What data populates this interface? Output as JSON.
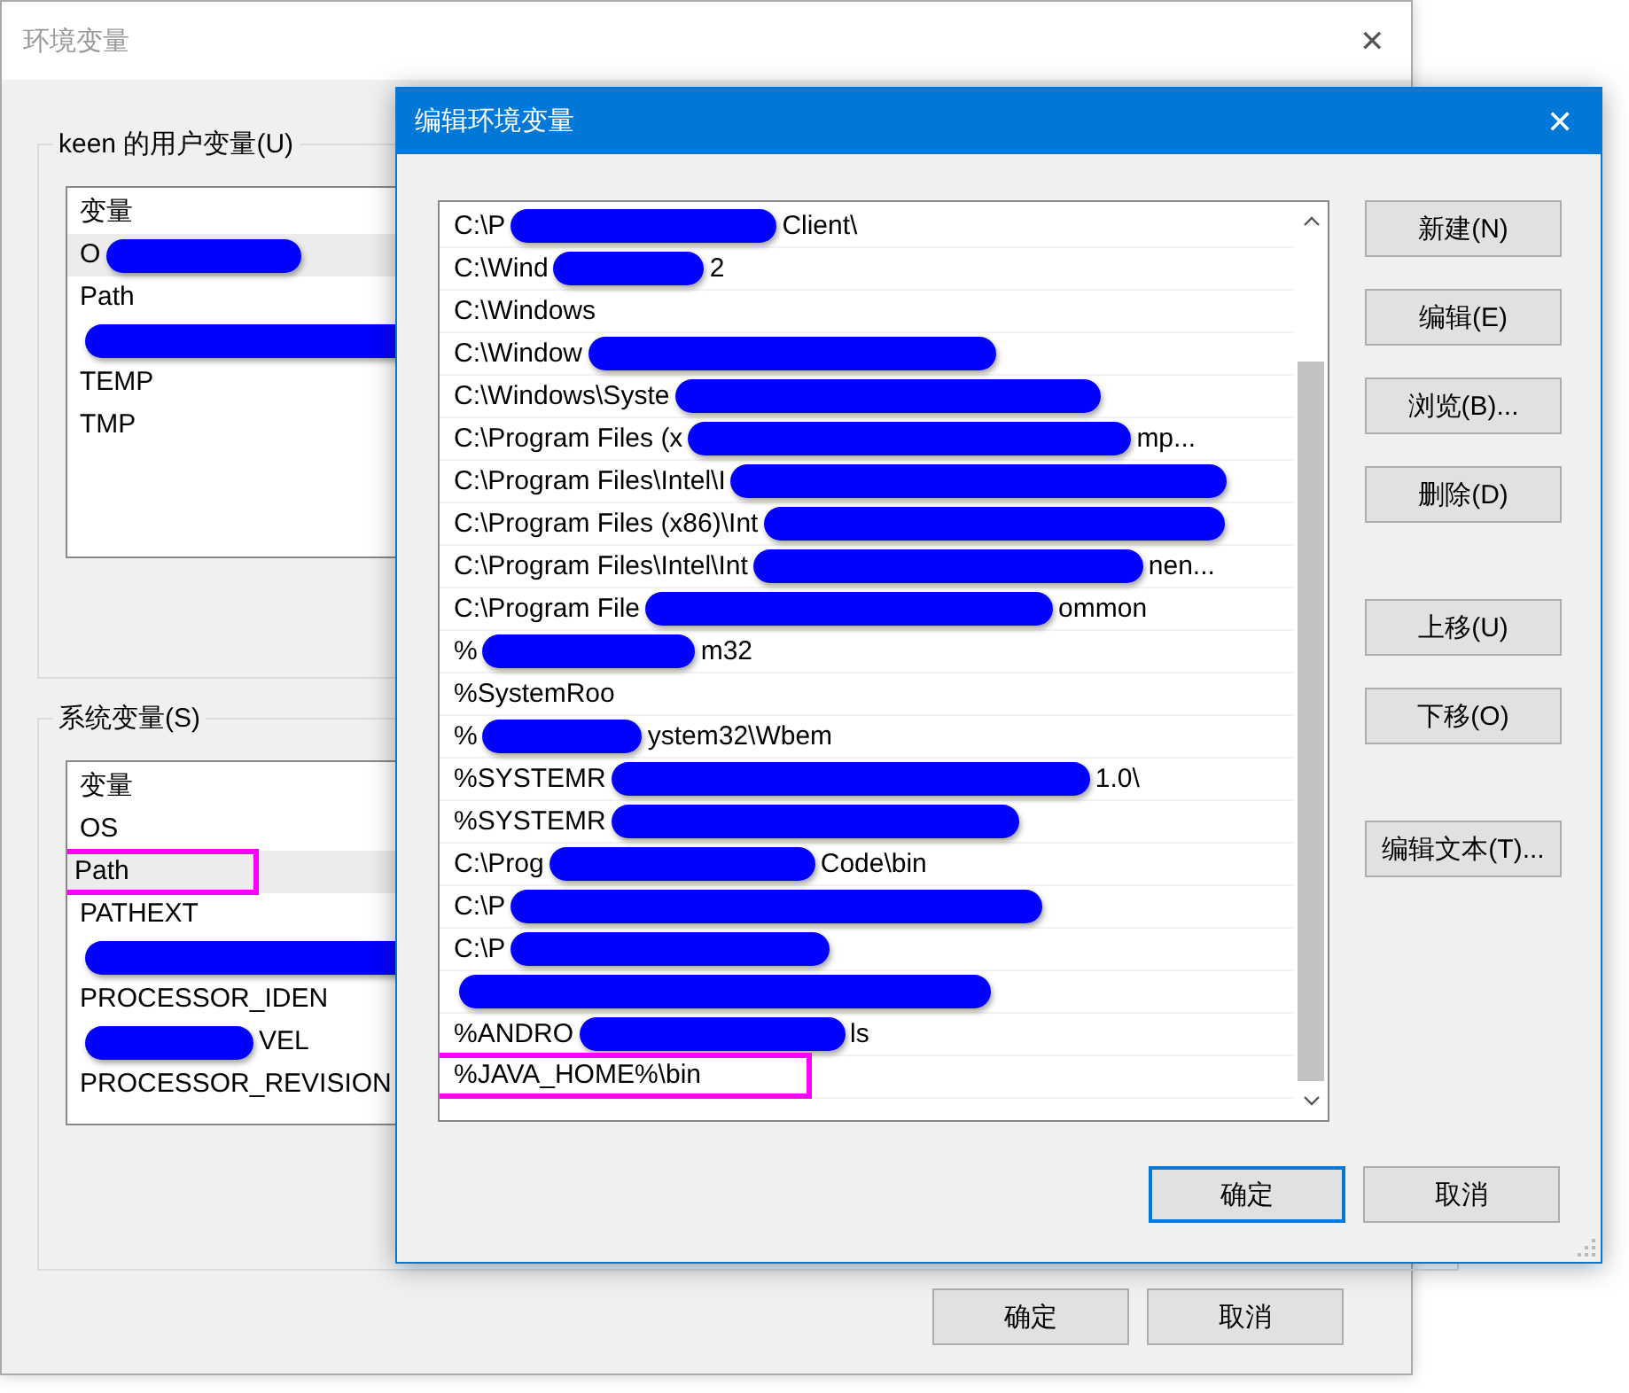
{
  "back_window": {
    "title": "环境变量",
    "close": "✕",
    "user_group": {
      "title": "keen 的用户变量(U)",
      "header": "变量",
      "rows": [
        {
          "parts": [
            "O"
          ],
          "selected": true,
          "annotated": false
        },
        {
          "parts": [
            "Path"
          ],
          "selected": false,
          "annotated": false
        },
        {
          "selected": false,
          "annotated": false
        },
        {
          "parts": [
            "TEMP"
          ],
          "selected": false,
          "annotated": false
        },
        {
          "parts": [
            "TMP"
          ],
          "selected": false,
          "annotated": false
        }
      ]
    },
    "system_group": {
      "title": "系统变量(S)",
      "header": "变量",
      "rows": [
        {
          "parts": [
            "OS"
          ],
          "selected": false,
          "annotated": false
        },
        {
          "parts": [
            "Path"
          ],
          "selected": true,
          "annotated": true
        },
        {
          "parts": [
            "PATHEXT"
          ],
          "selected": false,
          "annotated": false
        },
        {
          "selected": false,
          "annotated": false
        },
        {
          "parts": [
            "PROCESSOR_IDEN"
          ],
          "selected": false,
          "annotated": false
        },
        {
          "parts": [
            "VEL"
          ],
          "selected": false,
          "annotated": false
        },
        {
          "parts": [
            "PROCESSOR_REVISION"
          ],
          "selected": false,
          "annotated": false
        }
      ]
    },
    "buttons": [
      "确定",
      "取消"
    ]
  },
  "edit_window": {
    "title": "编辑环境变量",
    "close": "✕",
    "paths": [
      {
        "parts": [
          "C:\\P",
          "Client\\"
        ],
        "annotated": false
      },
      {
        "parts": [
          "C:\\Wind",
          "2"
        ],
        "annotated": false
      },
      {
        "parts": [
          "C:\\Windows"
        ],
        "annotated": false
      },
      {
        "parts": [
          "C:\\Window"
        ],
        "annotated": false
      },
      {
        "parts": [
          "C:\\Windows\\Syste"
        ],
        "annotated": false
      },
      {
        "parts": [
          "C:\\Program Files (x",
          "mp..."
        ],
        "annotated": false
      },
      {
        "parts": [
          "C:\\Program Files\\Intel\\I"
        ],
        "annotated": false
      },
      {
        "parts": [
          "C:\\Program Files (x86)\\Int"
        ],
        "annotated": false
      },
      {
        "parts": [
          "C:\\Program Files\\Intel\\Int",
          "nen..."
        ],
        "annotated": false
      },
      {
        "parts": [
          "C:\\Program File",
          "ommon"
        ],
        "annotated": false
      },
      {
        "parts": [
          "%",
          "m32"
        ],
        "annotated": false
      },
      {
        "parts": [
          "%SystemRoo"
        ],
        "annotated": false
      },
      {
        "parts": [
          "%",
          "ystem32\\Wbem"
        ],
        "annotated": false
      },
      {
        "parts": [
          "%SYSTEMR",
          "1.0\\"
        ],
        "annotated": false
      },
      {
        "parts": [
          "%SYSTEMR"
        ],
        "annotated": false
      },
      {
        "parts": [
          "C:\\Prog",
          "Code\\bin"
        ],
        "annotated": false
      },
      {
        "parts": [
          "C:\\P"
        ],
        "annotated": false
      },
      {
        "parts": [
          "C:\\P"
        ],
        "annotated": false
      },
      {
        "annotated": false
      },
      {
        "parts": [
          "%ANDRO",
          "ls"
        ],
        "annotated": false
      },
      {
        "parts": [
          "%JAVA_HOME%\\bin"
        ],
        "annotated": true
      }
    ],
    "side_buttons": [
      {
        "label": "新建(N)",
        "kind": "button"
      },
      {
        "label": "编辑(E)",
        "kind": "button"
      },
      {
        "label": "浏览(B)...",
        "kind": "button"
      },
      {
        "label": "删除(D)",
        "kind": "button"
      },
      {
        "label": "上移(U)",
        "kind": "spaced"
      },
      {
        "label": "下移(O)",
        "kind": "button"
      },
      {
        "label": "编辑文本(T)...",
        "kind": "spaced"
      }
    ],
    "ok": "确定",
    "cancel": "取消"
  }
}
